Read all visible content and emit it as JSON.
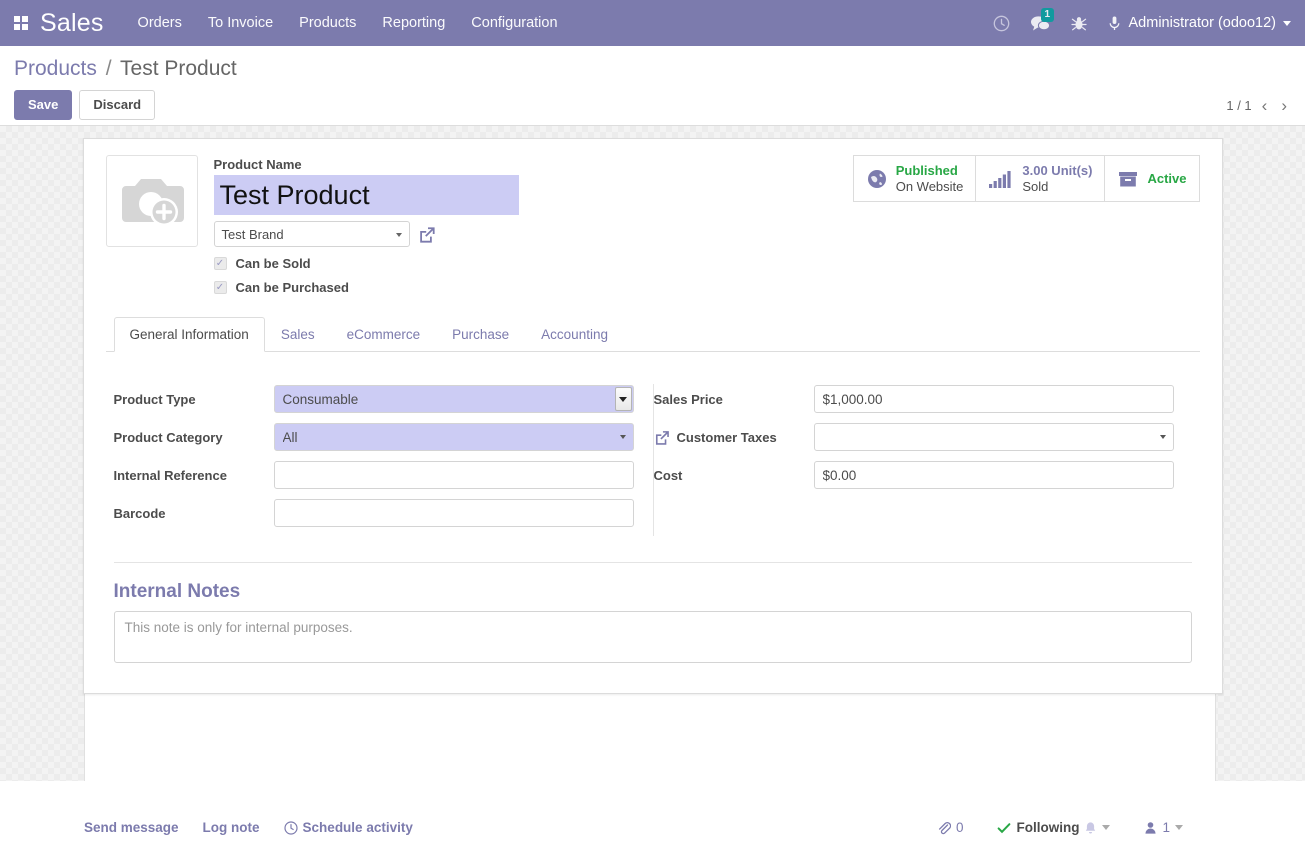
{
  "navbar": {
    "apps_icon": "apps-grid-icon",
    "brand": "Sales",
    "menu": [
      {
        "label": "Orders"
      },
      {
        "label": "To Invoice"
      },
      {
        "label": "Products"
      },
      {
        "label": "Reporting"
      },
      {
        "label": "Configuration"
      }
    ],
    "icons": {
      "activity": "clock-icon",
      "messages": "chat-bubble-icon",
      "messages_badge": "1",
      "debug": "bug-icon",
      "user_avatar": "user-avatar-icon"
    },
    "user": "Administrator (odoo12)",
    "brand_color": "#7c7bad"
  },
  "control_panel": {
    "breadcrumb_root": "Products",
    "breadcrumb_sep": "/",
    "breadcrumb_current": "Test Product",
    "save_label": "Save",
    "discard_label": "Discard",
    "pager_value": "1 / 1",
    "pager_prev": "‹",
    "pager_next": "›"
  },
  "stat_buttons": [
    {
      "icon": "globe-icon",
      "value": "Published",
      "label": "On Website",
      "value_color": "#28a745"
    },
    {
      "icon": "bar-chart-icon",
      "value": "3.00 Unit(s)",
      "label": "Sold",
      "value_color": "#7c7bad"
    },
    {
      "icon": "archive-box-icon",
      "value": "Active",
      "label": "",
      "value_color": "#28a745"
    }
  ],
  "header": {
    "image_placeholder_icon": "camera-plus-icon",
    "product_name_label": "Product Name",
    "product_name_value": "Test Product",
    "brand_value": "Test Brand",
    "brand_external_icon": "external-link-icon",
    "checkboxes": [
      {
        "label": "Can be Sold",
        "checked": true
      },
      {
        "label": "Can be Purchased",
        "checked": true
      }
    ],
    "selection_color": "#ccccf4"
  },
  "tabs": [
    {
      "label": "General Information",
      "active": true
    },
    {
      "label": "Sales",
      "active": false
    },
    {
      "label": "eCommerce",
      "active": false
    },
    {
      "label": "Purchase",
      "active": false
    },
    {
      "label": "Accounting",
      "active": false
    }
  ],
  "form": {
    "left": [
      {
        "label": "Product Type",
        "value": "Consumable",
        "type": "select",
        "highlighted": true
      },
      {
        "label": "Product Category",
        "value": "All",
        "type": "many2one",
        "highlighted": true
      },
      {
        "label": "Internal Reference",
        "value": "",
        "type": "text",
        "highlighted": false
      },
      {
        "label": "Barcode",
        "value": "",
        "type": "text",
        "highlighted": false
      }
    ],
    "right": [
      {
        "label": "Sales Price",
        "value": "$1,000.00",
        "type": "text",
        "icon": ""
      },
      {
        "label": "Customer Taxes",
        "value": "",
        "type": "many2one",
        "icon": "external-link-icon"
      },
      {
        "label": "Cost",
        "value": "$0.00",
        "type": "text",
        "icon": ""
      }
    ]
  },
  "notes": {
    "title": "Internal Notes",
    "placeholder": "This note is only for internal purposes.",
    "title_color": "#7c7bad"
  },
  "chatter": {
    "send_message": "Send message",
    "log_note": "Log note",
    "schedule_activity": "Schedule activity",
    "schedule_icon": "clock-icon",
    "attachment_icon": "paperclip-icon",
    "attachment_count": "0",
    "following_label": "Following",
    "following_check_icon": "check-icon",
    "bell_icon": "bell-icon",
    "followers_icon": "user-icon",
    "followers_count": "1"
  }
}
